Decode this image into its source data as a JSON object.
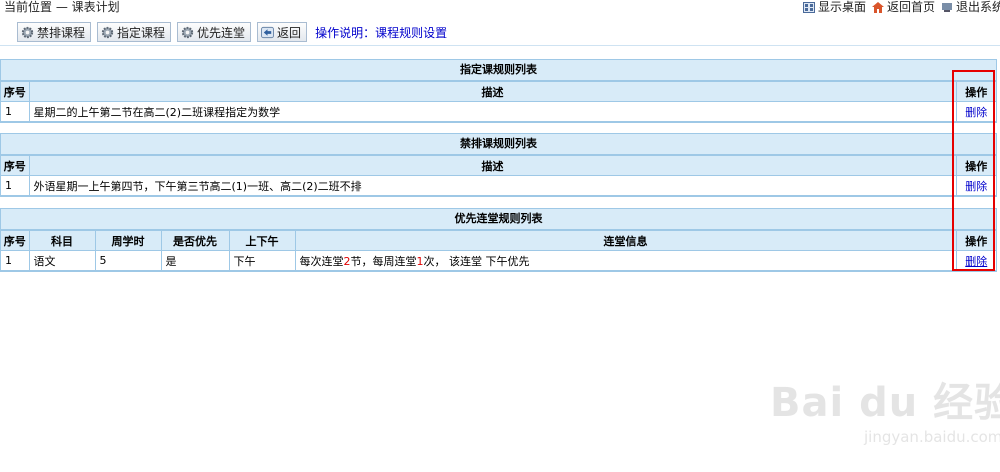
{
  "header": {
    "breadcrumb": "当前位置 — 课表计划",
    "links": [
      {
        "label": "显示桌面",
        "icon": "desktop-icon"
      },
      {
        "label": "返回首页",
        "icon": "home-icon"
      },
      {
        "label": "退出系统",
        "icon": "exit-icon"
      }
    ]
  },
  "toolbar": {
    "buttons": [
      {
        "label": "禁排课程",
        "icon": "gear-icon"
      },
      {
        "label": "指定课程",
        "icon": "gear-icon"
      },
      {
        "label": "优先连堂",
        "icon": "gear-icon"
      },
      {
        "label": "返回",
        "icon": "back-icon"
      }
    ],
    "help_text": "操作说明：课程规则设置"
  },
  "assign_table": {
    "title": "指定课规则列表",
    "headers": [
      "序号",
      "描述",
      "操作"
    ],
    "rows": [
      {
        "index": "1",
        "description": "星期二的上午第二节在高二(2)二班课程指定为数学",
        "action": "删除"
      }
    ]
  },
  "ban_table": {
    "title": "禁排课规则列表",
    "headers": [
      "序号",
      "描述",
      "操作"
    ],
    "rows": [
      {
        "index": "1",
        "description": "外语星期一上午第四节，下午第三节高二(1)一班、高二(2)二班不排",
        "action": "删除"
      }
    ]
  },
  "priority_table": {
    "title": "优先连堂规则列表",
    "headers": [
      "序号",
      "科目",
      "周学时",
      "是否优先",
      "上下午",
      "连堂信息",
      "操作"
    ],
    "rows": [
      {
        "index": "1",
        "subject": "语文",
        "hours": "5",
        "priority": "是",
        "period": "下午",
        "info": {
          "p1": "每次连堂",
          "n1": "2",
          "p2": "节，每周连堂",
          "n2": "1",
          "p3": "次， 该连堂 下午优先"
        },
        "action": "删除"
      }
    ]
  },
  "watermark": {
    "main": "Bai du 经验",
    "sub": "jingyan.baidu.com"
  },
  "colors": {
    "header_bg": "#d8ebf8",
    "border": "#9ec8e6",
    "link": "#0000cc",
    "highlight_box": "#e60000"
  }
}
